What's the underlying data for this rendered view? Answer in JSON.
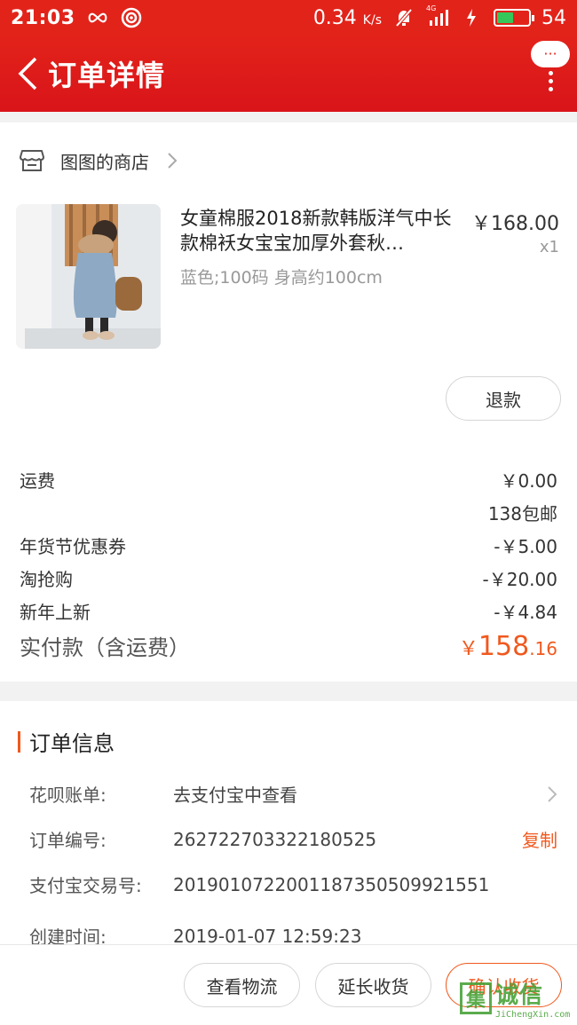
{
  "status_bar": {
    "time": "21:03",
    "network_speed": "0.34",
    "speed_unit": "K/s",
    "network_type": "4G",
    "battery_level": "54",
    "battery_fraction": 0.54
  },
  "nav": {
    "title": "订单详情",
    "more_label": "···"
  },
  "shop": {
    "name": "图图的商店"
  },
  "product": {
    "title": "女童棉服2018新款韩版洋气中长款棉袄女宝宝加厚外套秋…",
    "spec": "蓝色;100码 身高约100cm",
    "price": "￥168.00",
    "quantity": "x1",
    "refund_label": "退款"
  },
  "fees": [
    {
      "label": "运费",
      "value": "￥0.00"
    },
    {
      "label": "",
      "value": "138包邮"
    },
    {
      "label": "年货节优惠券",
      "value": "-￥5.00"
    },
    {
      "label": "淘抢购",
      "value": "-￥20.00"
    },
    {
      "label": "新年上新",
      "value": "-￥4.84"
    }
  ],
  "total": {
    "label": "实付款（含运费）",
    "currency": "￥",
    "integer": "158",
    "decimal": ".16"
  },
  "order_info": {
    "title": "订单信息",
    "rows": [
      {
        "label": "花呗账单:",
        "value": "去支付宝中查看"
      },
      {
        "label": "订单编号:",
        "value": "262722703322180525",
        "action": "复制"
      },
      {
        "label": "支付宝交易号:",
        "value": "2019010722001187350509921551"
      },
      {
        "label": "创建时间:",
        "value": "2019-01-07 12:59:23"
      }
    ]
  },
  "actions": {
    "logistics": "查看物流",
    "extend": "延长收货",
    "confirm": "确认收货"
  },
  "watermark": {
    "box": "集",
    "cn": "诚信",
    "en": "JiChengXin.com"
  },
  "colors": {
    "brand_red": "#e2231a",
    "accent_orange": "#f0591e",
    "battery_green": "#35c759"
  }
}
